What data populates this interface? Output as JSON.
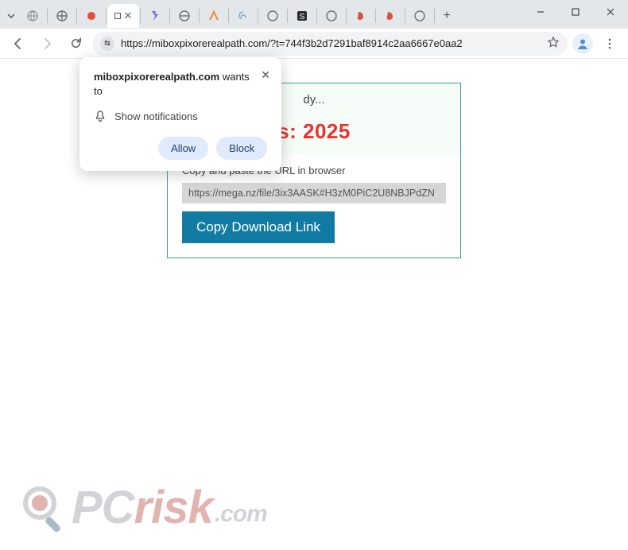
{
  "window": {
    "dropdown_icon": "chevron-down",
    "controls": {
      "min": "–",
      "max": "▢",
      "close": "✕"
    }
  },
  "tabs": {
    "active_close": "✕",
    "new_tab": "+"
  },
  "toolbar": {
    "url": "https://miboxpixorerealpath.com/?t=744f3b2d7291baf8914c2aa6667e0aa2",
    "site_chip": "⇆"
  },
  "notification": {
    "domain": "miboxpixorerealpath.com",
    "wants_to": " wants to",
    "line": "Show notifications",
    "allow": "Allow",
    "block": "Block",
    "close": "✕"
  },
  "page_content": {
    "header_suffix": "dy...",
    "big_red_prefix": "s: ",
    "big_red_year": "2025",
    "instruction": "Copy and paste the URL in browser",
    "download_url": "https://mega.nz/file/3ix3AASK#H3zM0PiC2U8NBJPdZN",
    "copy_button": "Copy Download Link"
  },
  "watermark": {
    "pc": "PC",
    "risk": "risk",
    "com": ".com"
  },
  "colors": {
    "accent_teal": "#3da08c",
    "danger_red": "#e8322c",
    "button_blue": "#127ba3",
    "prompt_btn": "#dfeafd"
  }
}
